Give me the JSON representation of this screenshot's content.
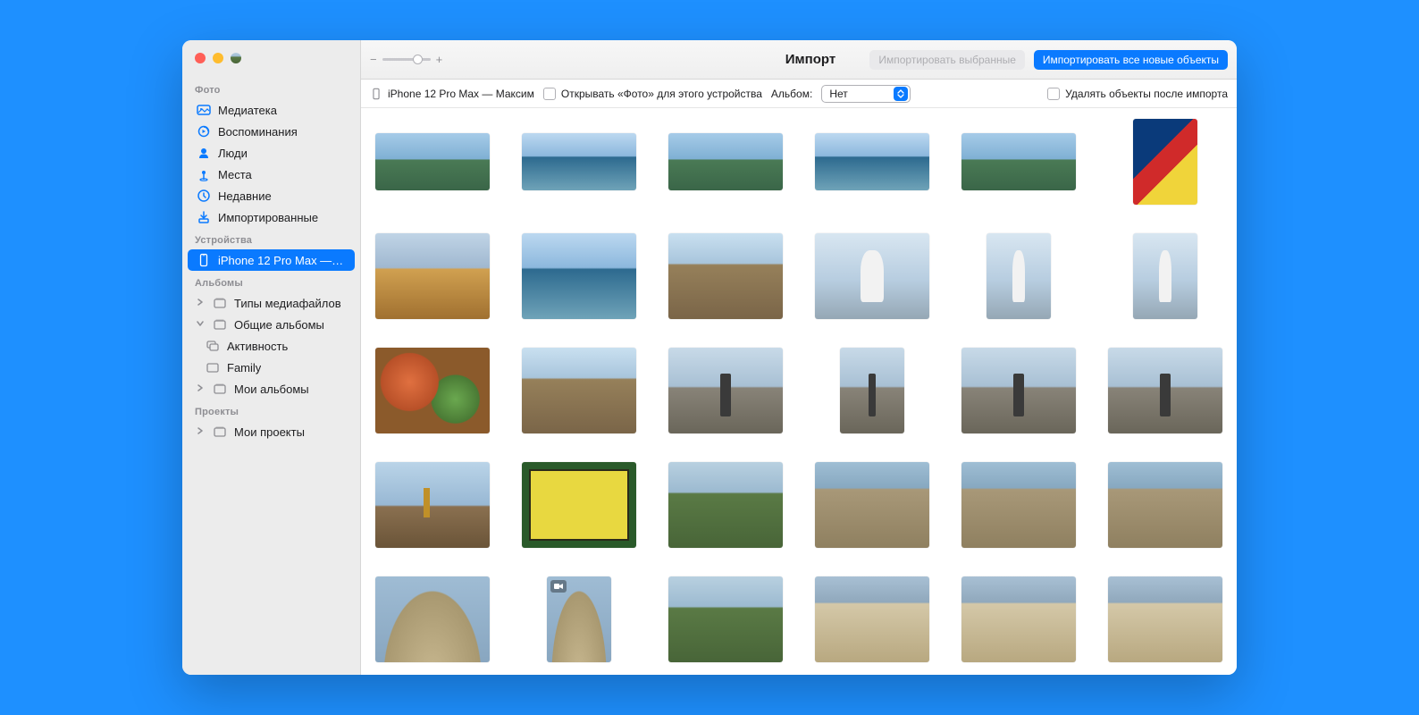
{
  "toolbar": {
    "title": "Импорт",
    "import_selected": "Импортировать выбранные",
    "import_all": "Импортировать все новые объекты"
  },
  "subbar": {
    "device": "iPhone 12 Pro Max — Максим",
    "open_photos": "Открывать «Фото» для этого устройства",
    "album_label": "Альбом:",
    "album_value": "Нет",
    "delete_after": "Удалять объекты после импорта"
  },
  "sidebar": {
    "section_photo": "Фото",
    "library": "Медиатека",
    "memories": "Воспоминания",
    "people": "Люди",
    "places": "Места",
    "recent": "Недавние",
    "imported": "Импортированные",
    "section_devices": "Устройства",
    "device_name": "iPhone 12 Pro Max —…",
    "section_albums": "Альбомы",
    "media_types": "Типы медиафайлов",
    "shared_albums": "Общие альбомы",
    "activity": "Активность",
    "family": "Family",
    "my_albums": "Мои альбомы",
    "section_projects": "Проекты",
    "my_projects": "Мои проекты"
  },
  "thumbs": [
    {
      "shape": "wide",
      "pal": "sea2"
    },
    {
      "shape": "wide",
      "pal": "sea"
    },
    {
      "shape": "wide",
      "pal": "sea2"
    },
    {
      "shape": "wide",
      "pal": "sea"
    },
    {
      "shape": "wide",
      "pal": "sea2"
    },
    {
      "shape": "portrait",
      "pal": "abstract"
    },
    {
      "shape": "landscape",
      "pal": "market"
    },
    {
      "shape": "landscape",
      "pal": "sea"
    },
    {
      "shape": "landscape",
      "pal": "hill"
    },
    {
      "shape": "landscape",
      "pal": "sculpt"
    },
    {
      "shape": "portrait",
      "pal": "sculpt"
    },
    {
      "shape": "portrait",
      "pal": "sculpt"
    },
    {
      "shape": "landscape",
      "pal": "food"
    },
    {
      "shape": "landscape",
      "pal": "hill"
    },
    {
      "shape": "landscape",
      "pal": "statue"
    },
    {
      "shape": "portrait",
      "pal": "statue"
    },
    {
      "shape": "landscape",
      "pal": "statue"
    },
    {
      "shape": "landscape",
      "pal": "statue"
    },
    {
      "shape": "landscape",
      "pal": "castle"
    },
    {
      "shape": "landscape",
      "pal": "sign"
    },
    {
      "shape": "landscape",
      "pal": "green"
    },
    {
      "shape": "landscape",
      "pal": "ruins"
    },
    {
      "shape": "landscape",
      "pal": "ruins"
    },
    {
      "shape": "landscape",
      "pal": "ruins"
    },
    {
      "shape": "landscape",
      "pal": "amphi"
    },
    {
      "shape": "portrait",
      "pal": "amphi",
      "video": true
    },
    {
      "shape": "landscape",
      "pal": "green"
    },
    {
      "shape": "landscape",
      "pal": "colonnade"
    },
    {
      "shape": "landscape",
      "pal": "colonnade"
    },
    {
      "shape": "landscape",
      "pal": "colonnade"
    }
  ]
}
